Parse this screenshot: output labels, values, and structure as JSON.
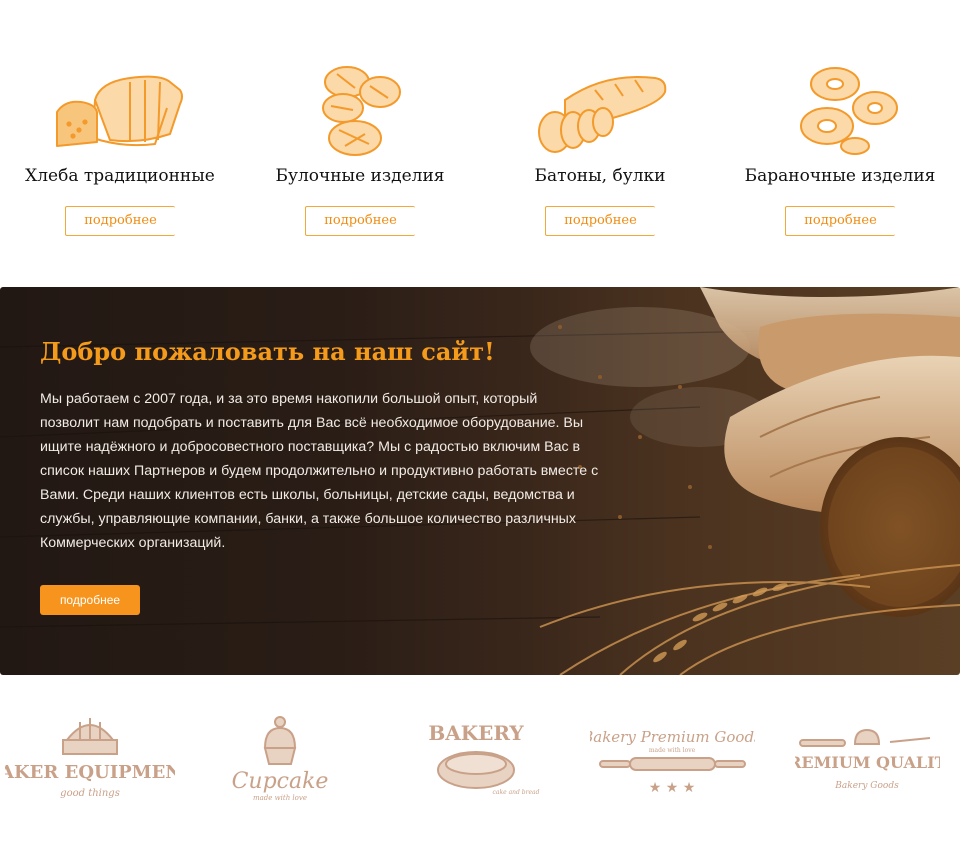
{
  "categories": [
    {
      "name": "Хлеба традиционные",
      "button": "подробнее",
      "icon": "bread-loaf-icon"
    },
    {
      "name": "Булочные изделия",
      "button": "подробнее",
      "icon": "buns-icon"
    },
    {
      "name": "Батоны, булки",
      "button": "подробнее",
      "icon": "baguette-icon"
    },
    {
      "name": "Бараночные изделия",
      "button": "подробнее",
      "icon": "pretzels-icon"
    }
  ],
  "welcome": {
    "title": "Добро пожаловать на наш сайт!",
    "text": "Мы работаем с 2007 года, и за это время накопили большой опыт, который позволит нам подобрать и поставить для Вас всё необходимое оборудование. Вы ищите надёжного и добросовестного поставщика? Мы с радостью включим Вас в список наших Партнеров и будем продолжительно и продуктивно работать вместе с Вами. Среди наших клиентов есть школы, больницы, детские сады, ведомства и службы, управляющие компании, банки, а также большое количество различных Коммерческих организаций.",
    "button": "подробнее"
  },
  "logos": [
    {
      "main": "BAKER EQUIPMENT",
      "sub": "good things"
    },
    {
      "main": "Cupcake",
      "sub": "made with love"
    },
    {
      "main": "BAKERY",
      "sub": "cake and bread"
    },
    {
      "main": "Bakery Premium Goods",
      "sub": "made with love"
    },
    {
      "main": "PREMIUM QUALITY",
      "sub": "Bakery Goods"
    }
  ],
  "colors": {
    "accent": "#f7941d",
    "icon": "#f39a2b",
    "logo": "#c9a189"
  }
}
